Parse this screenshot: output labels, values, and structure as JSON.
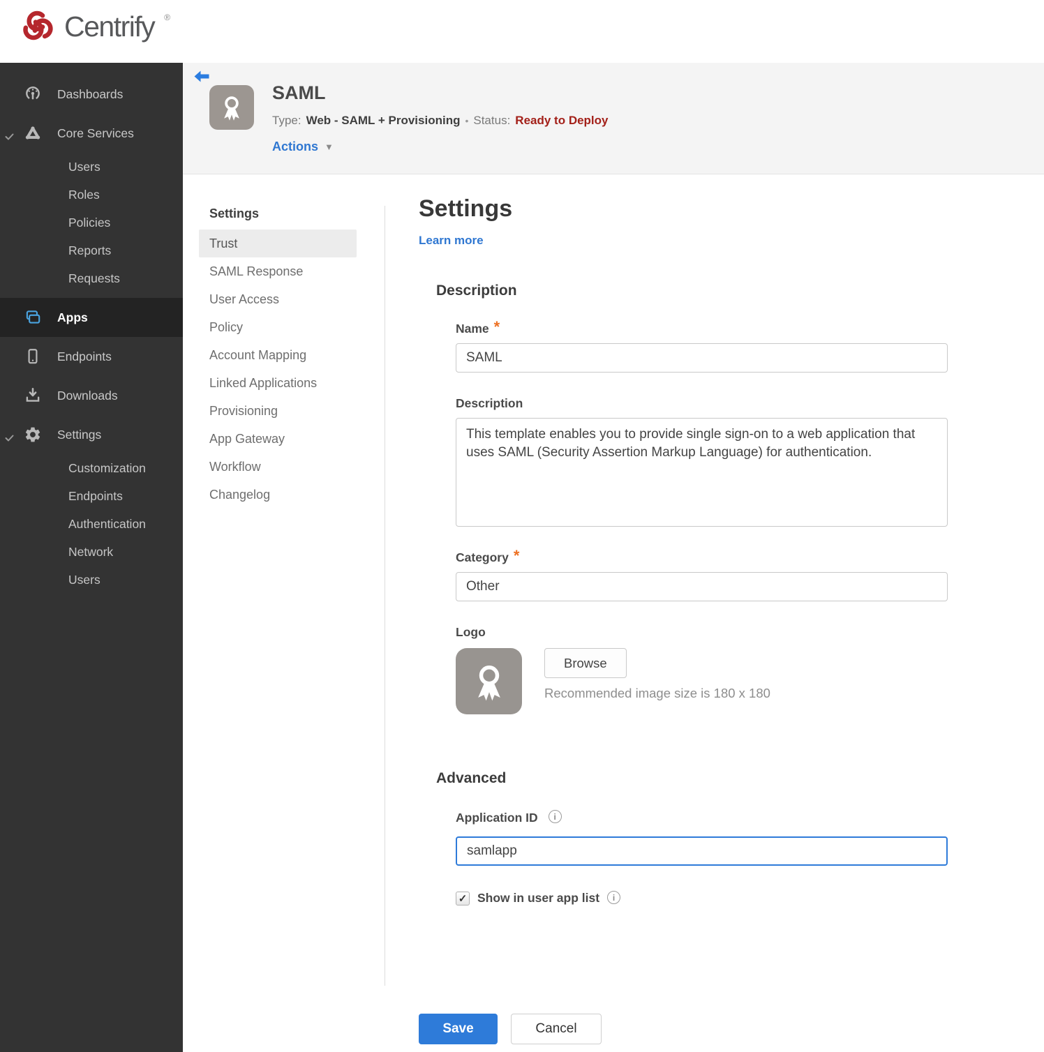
{
  "colors": {
    "brand_red": "#b5272d",
    "accent_blue": "#2f77d1",
    "save_blue": "#2e7bd9",
    "app_icon_blue": "#4aa3df",
    "status_red": "#a32019",
    "required_orange": "#ed7123",
    "sidebar_bg": "#333333",
    "header_band_bg": "#f4f4f4"
  },
  "brand": {
    "name": "Centrify",
    "registered": "®"
  },
  "sidebar": {
    "items": [
      {
        "label": "Dashboards"
      },
      {
        "label": "Core Services",
        "expanded": true,
        "children": [
          "Users",
          "Roles",
          "Policies",
          "Reports",
          "Requests"
        ]
      },
      {
        "label": "Apps",
        "active": true
      },
      {
        "label": "Endpoints"
      },
      {
        "label": "Downloads"
      },
      {
        "label": "Settings",
        "expanded": true,
        "children": [
          "Customization",
          "Endpoints",
          "Authentication",
          "Network",
          "Users"
        ]
      }
    ]
  },
  "header": {
    "title": "SAML",
    "type_label": "Type:",
    "type_value": "Web - SAML + Provisioning",
    "bullet": "•",
    "status_label": "Status:",
    "status_value": "Ready to Deploy",
    "actions_label": "Actions"
  },
  "subnav": {
    "header": "Settings",
    "active_item": "Trust",
    "items": [
      "Trust",
      "SAML Response",
      "User Access",
      "Policy",
      "Account Mapping",
      "Linked Applications",
      "Provisioning",
      "App Gateway",
      "Workflow",
      "Changelog"
    ]
  },
  "main": {
    "title": "Settings",
    "learn_more_label": "Learn more",
    "description": {
      "heading": "Description",
      "name_label": "Name",
      "required_mark": "*",
      "name_value": "SAML",
      "description_label": "Description",
      "description_value": "This template enables you to provide single sign-on to a web application that uses SAML (Security Assertion Markup Language) for authentication.",
      "category_label": "Category",
      "category_value": "Other",
      "logo_label": "Logo",
      "browse_label": "Browse",
      "logo_hint": "Recommended image size is 180 x 180"
    },
    "advanced": {
      "heading": "Advanced",
      "app_id_label": "Application ID",
      "app_id_value": "samlapp",
      "show_label": "Show in user app list",
      "checkbox_checked": true,
      "checkmark": "✓",
      "info_glyph": "i"
    },
    "footer": {
      "save_label": "Save",
      "cancel_label": "Cancel"
    }
  }
}
